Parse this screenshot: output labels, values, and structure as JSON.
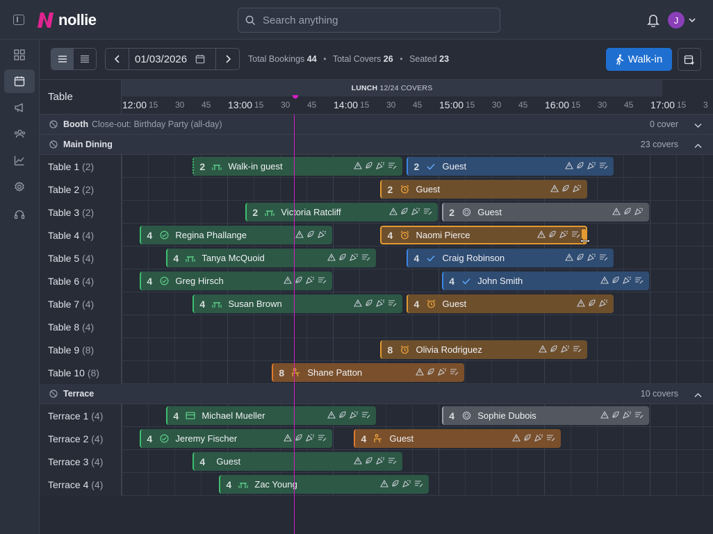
{
  "brand": {
    "name": "nollie",
    "accent": "#e0248f"
  },
  "header": {
    "search_placeholder": "Search anything",
    "avatar_initial": "J"
  },
  "nav": [
    "grid-icon",
    "calendar-icon",
    "megaphone-icon",
    "guests-icon",
    "analytics-icon",
    "settings-icon",
    "headset-icon"
  ],
  "toolbar": {
    "date": "01/03/2026",
    "total_bookings_label": "Total Bookings",
    "total_bookings": "44",
    "total_covers_label": "Total Covers",
    "total_covers": "26",
    "seated_label": "Seated",
    "seated": "23",
    "walkin_label": "Walk-in"
  },
  "grid": {
    "table_header": "Table",
    "service_name": "LUNCH",
    "service_covers": "12/24 COVERS",
    "ticks": [
      "12:00",
      "15",
      "30",
      "45",
      "13:00",
      "15",
      "30",
      "45",
      "14:00",
      "15",
      "30",
      "45",
      "15:00",
      "15",
      "30",
      "45",
      "16:00",
      "15",
      "30",
      "45",
      "17:00",
      "15",
      "3"
    ]
  },
  "sections": [
    {
      "name": "Booth",
      "note": "Close-out: Birthday Party (all-day)",
      "covers": "0 cover",
      "expanded": false,
      "tables": []
    },
    {
      "name": "Main Dining",
      "note": "",
      "covers": "23 covers",
      "expanded": true,
      "tables": [
        {
          "name": "Table 1",
          "cap": "(2)",
          "bookings": [
            {
              "start": 12.667,
              "end": 14.667,
              "covers": "2",
              "name": "Walk-in guest",
              "status": "green",
              "dotted": true,
              "icon": "table-icon",
              "icons": 4
            },
            {
              "start": 14.694,
              "end": 16.667,
              "covers": "2",
              "name": "Guest",
              "status": "blue",
              "icon": "check-icon",
              "icons": 4
            }
          ]
        },
        {
          "name": "Table 2",
          "cap": "(2)",
          "bookings": [
            {
              "start": 14.444,
              "end": 16.417,
              "covers": "2",
              "name": "Guest",
              "status": "orange",
              "icon": "alarm-icon",
              "icons": 3
            }
          ]
        },
        {
          "name": "Table 3",
          "cap": "(2)",
          "bookings": [
            {
              "start": 13.167,
              "end": 15.0,
              "covers": "2",
              "name": "Victoria Ratcliff",
              "status": "green",
              "icon": "table-icon",
              "icons": 4
            },
            {
              "start": 15.028,
              "end": 17.0,
              "covers": "2",
              "name": "Guest",
              "status": "grey",
              "icon": "clock-icon",
              "icons": 3
            }
          ]
        },
        {
          "name": "Table 4",
          "cap": "(4)",
          "bookings": [
            {
              "start": 12.167,
              "end": 14.0,
              "covers": "4",
              "name": "Regina Phallange",
              "status": "green",
              "icon": "check-circle-icon",
              "icons": 3
            },
            {
              "start": 14.444,
              "end": 16.417,
              "covers": "4",
              "name": "Naomi Pierce",
              "status": "orange",
              "sel": true,
              "icon": "alarm-icon",
              "icons": 4
            }
          ]
        },
        {
          "name": "Table 5",
          "cap": "(4)",
          "bookings": [
            {
              "start": 12.417,
              "end": 14.417,
              "covers": "4",
              "name": "Tanya McQuoid",
              "status": "green",
              "icon": "table-icon",
              "icons": 4
            },
            {
              "start": 14.694,
              "end": 16.667,
              "covers": "4",
              "name": "Craig Robinson",
              "status": "blue",
              "icon": "check-icon",
              "icons": 4
            }
          ]
        },
        {
          "name": "Table 6",
          "cap": "(4)",
          "bookings": [
            {
              "start": 12.167,
              "end": 14.0,
              "covers": "4",
              "name": "Greg Hirsch",
              "status": "green",
              "icon": "check-circle-icon",
              "icons": 4
            },
            {
              "start": 15.028,
              "end": 17.0,
              "covers": "4",
              "name": "John Smith",
              "status": "blue",
              "icon": "check-icon",
              "icons": 4
            }
          ]
        },
        {
          "name": "Table 7",
          "cap": "(4)",
          "bookings": [
            {
              "start": 12.667,
              "end": 14.667,
              "covers": "4",
              "name": "Susan Brown",
              "status": "green",
              "icon": "table-icon",
              "icons": 4
            },
            {
              "start": 14.694,
              "end": 16.667,
              "covers": "4",
              "name": "Guest",
              "status": "orange",
              "icon": "alarm-icon",
              "icons": 3
            }
          ]
        },
        {
          "name": "Table 8",
          "cap": "(4)",
          "bookings": []
        },
        {
          "name": "Table 9",
          "cap": "(8)",
          "bookings": [
            {
              "start": 14.444,
              "end": 16.417,
              "covers": "8",
              "name": "Olivia Rodriguez",
              "status": "orange",
              "icon": "alarm-icon",
              "icons": 4
            }
          ]
        },
        {
          "name": "Table 10",
          "cap": "(8)",
          "bookings": [
            {
              "start": 13.417,
              "end": 15.25,
              "covers": "8",
              "name": "Shane Patton",
              "status": "seated",
              "icon": "seat-icon",
              "icons": 4
            }
          ]
        }
      ]
    },
    {
      "name": "Terrace",
      "note": "",
      "covers": "10 covers",
      "expanded": true,
      "tables": [
        {
          "name": "Terrace 1",
          "cap": "(4)",
          "bookings": [
            {
              "start": 12.417,
              "end": 14.417,
              "covers": "4",
              "name": "Michael Mueller",
              "status": "green",
              "icon": "card-icon",
              "icons": 4
            },
            {
              "start": 15.028,
              "end": 17.0,
              "covers": "4",
              "name": "Sophie Dubois",
              "status": "grey",
              "icon": "clock-icon",
              "icons": 4
            }
          ]
        },
        {
          "name": "Terrace 2",
          "cap": "(4)",
          "bookings": [
            {
              "start": 12.167,
              "end": 14.0,
              "covers": "4",
              "name": "Jeremy Fischer",
              "status": "green",
              "icon": "check-circle-icon",
              "icons": 4
            },
            {
              "start": 14.194,
              "end": 16.167,
              "covers": "4",
              "name": "Guest",
              "status": "seated",
              "icon": "seat-icon",
              "icons": 4
            }
          ]
        },
        {
          "name": "Terrace 3",
          "cap": "(4)",
          "bookings": [
            {
              "start": 12.667,
              "end": 14.667,
              "covers": "4",
              "name": "Guest",
              "status": "green",
              "icon": "",
              "icons": 4
            }
          ]
        },
        {
          "name": "Terrace 4",
          "cap": "(4)",
          "bookings": [
            {
              "start": 12.917,
              "end": 14.917,
              "covers": "4",
              "name": "Zac Young",
              "status": "green",
              "icon": "table-icon",
              "icons": 4
            }
          ]
        }
      ]
    }
  ]
}
